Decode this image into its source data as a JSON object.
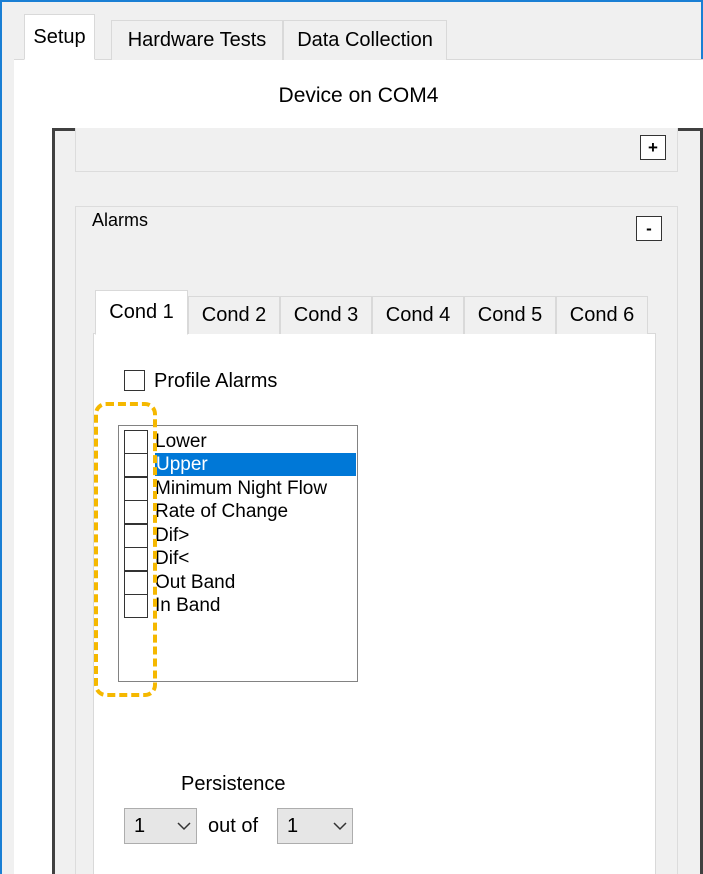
{
  "main_tabs": [
    {
      "label": "Setup",
      "active": true
    },
    {
      "label": "Hardware Tests",
      "active": false
    },
    {
      "label": "Data Collection",
      "active": false
    }
  ],
  "device_title": "Device on COM4",
  "collapsed_group": {
    "toggle_label": "+"
  },
  "alarms": {
    "legend": "Alarms",
    "toggle_label": "-",
    "cond_tabs": [
      {
        "label": "Cond 1",
        "active": true
      },
      {
        "label": "Cond 2",
        "active": false
      },
      {
        "label": "Cond 3",
        "active": false
      },
      {
        "label": "Cond 4",
        "active": false
      },
      {
        "label": "Cond 5",
        "active": false
      },
      {
        "label": "Cond 6",
        "active": false
      }
    ],
    "profile_alarms": {
      "label": "Profile Alarms",
      "checked": false
    },
    "alarm_types": [
      {
        "label": "Lower",
        "checked": false,
        "selected": false
      },
      {
        "label": "Upper",
        "checked": false,
        "selected": true
      },
      {
        "label": "Minimum Night Flow",
        "checked": false,
        "selected": false
      },
      {
        "label": "Rate of Change",
        "checked": false,
        "selected": false
      },
      {
        "label": "Dif>",
        "checked": false,
        "selected": false
      },
      {
        "label": "Dif<",
        "checked": false,
        "selected": false
      },
      {
        "label": "Out Band",
        "checked": false,
        "selected": false
      },
      {
        "label": "In Band",
        "checked": false,
        "selected": false
      }
    ],
    "persistence": {
      "label": "Persistence",
      "count_value": "1",
      "separator": "out of",
      "total_value": "1"
    }
  },
  "colors": {
    "selection": "#0078d7",
    "highlight_annotation": "#f5b800",
    "window_border": "#1a7fd4"
  }
}
